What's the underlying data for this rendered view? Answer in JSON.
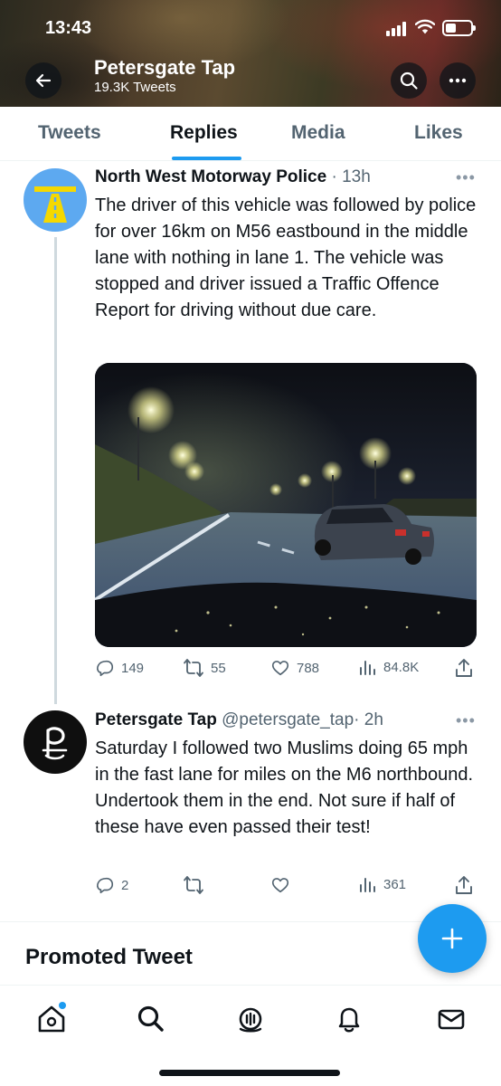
{
  "status_bar": {
    "time": "13:43"
  },
  "profile": {
    "name": "Petersgate Tap",
    "tweet_count": "19.3K Tweets"
  },
  "tabs": [
    {
      "label": "Tweets",
      "active": false
    },
    {
      "label": "Replies",
      "active": true
    },
    {
      "label": "Media",
      "active": false
    },
    {
      "label": "Likes",
      "active": false
    }
  ],
  "tweets": [
    {
      "author": "North West Motorway Police",
      "handle": "",
      "time": "· 13h",
      "text": "The driver of this vehicle was followed by police for over 16km on M56 eastbound in the middle lane with nothing in lane 1. The vehicle was stopped and driver issued a Traffic Offence Report for driving without due care.",
      "stats": {
        "replies": "149",
        "retweets": "55",
        "likes": "788",
        "views": "84.8K"
      }
    },
    {
      "author": "Petersgate Tap",
      "handle": "@petersgate_tap",
      "time": "· 2h",
      "text": "Saturday I followed two Muslims doing 65 mph in the fast lane for miles on the M6 northbound. Undertook them in the end. Not sure if half of these have even passed their test!",
      "stats": {
        "replies": "2",
        "retweets": "",
        "likes": "",
        "views": "361"
      }
    }
  ],
  "promoted": {
    "label": "Promoted Tweet"
  },
  "colors": {
    "accent": "#1d9bf0",
    "text": "#0f1419",
    "secondary": "#536471"
  },
  "icons": {
    "header": [
      "back-arrow-icon",
      "search-icon",
      "more-icon"
    ],
    "nav": [
      "home-icon",
      "search-icon",
      "spaces-icon",
      "notifications-icon",
      "messages-icon"
    ],
    "actions": [
      "reply-icon",
      "retweet-icon",
      "like-icon",
      "views-icon",
      "share-icon"
    ]
  }
}
